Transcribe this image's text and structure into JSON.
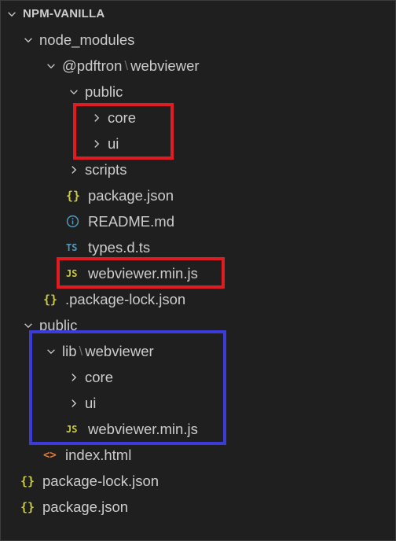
{
  "explorer": {
    "root_label": "NPM-VANILLA",
    "node_modules": "node_modules",
    "pdftron_scope": "@pdftron",
    "pdftron_pkg": "webviewer",
    "public_nm": "public",
    "core_nm": "core",
    "ui_nm": "ui",
    "scripts": "scripts",
    "package_json_nm": "package.json",
    "readme": "README.md",
    "types": "types.d.ts",
    "webviewer_min_nm": "webviewer.min.js",
    "package_lock_hidden": ".package-lock.json",
    "public_root": "public",
    "lib": "lib",
    "lib_webviewer": "webviewer",
    "core_pub": "core",
    "ui_pub": "ui",
    "webviewer_min_pub": "webviewer.min.js",
    "index_html": "index.html",
    "package_lock_root": "package-lock.json",
    "package_json_root": "package.json"
  },
  "icons": {
    "json": "{}",
    "js": "JS",
    "ts": "TS",
    "html": "<>"
  },
  "colors": {
    "background": "#1f1f1f",
    "highlight_red": "#e11b22",
    "highlight_blue": "#3b3bd8",
    "json_icon": "#cbcb41",
    "ts_icon": "#519aba",
    "html_icon": "#e37933"
  }
}
